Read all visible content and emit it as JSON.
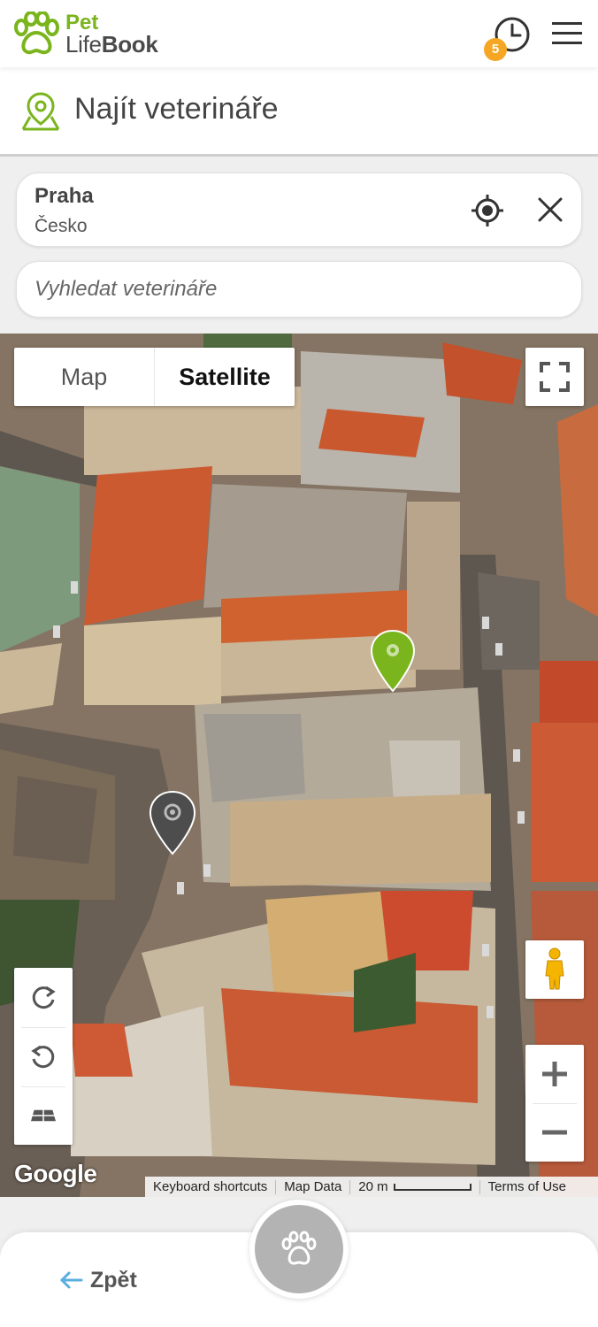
{
  "header": {
    "logo_line1": "Pet",
    "logo_line2_light": "Life",
    "logo_line2_bold": "Book",
    "history_badge_count": "5",
    "icons": {
      "logo": "paw-logo-icon",
      "history": "clock-history-icon",
      "menu": "hamburger-menu-icon"
    }
  },
  "page": {
    "title": "Najít veterináře",
    "title_icon": "map-pin-icon"
  },
  "search": {
    "location_city": "Praha",
    "location_country": "Česko",
    "vet_placeholder": "Vyhledat veterináře",
    "icons": {
      "locate": "crosshair-locate-icon",
      "clear": "close-icon"
    }
  },
  "map": {
    "type_options": [
      "Map",
      "Satellite"
    ],
    "selected_type": "Satellite",
    "provider_logo": "Google",
    "attribution": {
      "keyboard_shortcuts": "Keyboard shortcuts",
      "map_data": "Map Data",
      "scale": "20 m",
      "terms": "Terms of Use"
    },
    "markers": [
      {
        "name": "selected-vet-marker",
        "color": "#7ab51d"
      },
      {
        "name": "vet-marker",
        "color": "#4d4d4d"
      }
    ]
  },
  "bottom": {
    "back_label": "Zpět",
    "fab_icon": "paw-icon"
  },
  "colors": {
    "brand_green": "#7ab51d",
    "badge_orange": "#f5a623",
    "back_arrow_blue": "#5aaee0"
  }
}
